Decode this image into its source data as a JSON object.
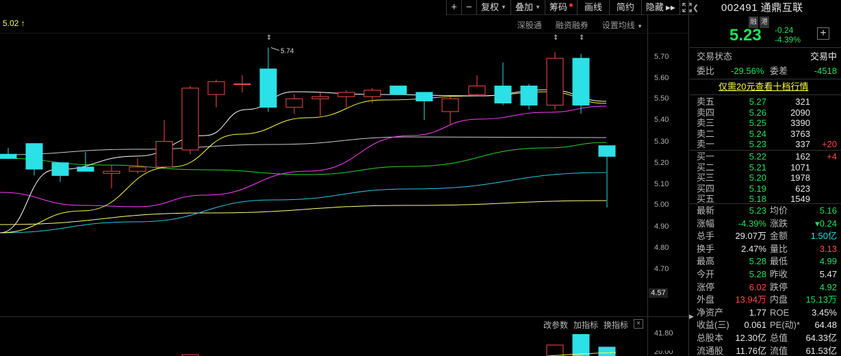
{
  "toolbar": {
    "plus": "+",
    "minus": "−",
    "fuquan": "复权",
    "diejia": "叠加",
    "chouma": "筹码",
    "huaxian": "画线",
    "jianyue": "简约",
    "yincang": "隐藏"
  },
  "chart_header": {
    "price": "5.02",
    "links": [
      "深股通",
      "融资融券",
      "设置均线"
    ]
  },
  "markers": {
    "high": "5.74"
  },
  "axis": {
    "labels": [
      "5.70",
      "5.60",
      "5.50",
      "5.40",
      "5.30",
      "5.20",
      "5.10",
      "5.00",
      "4.90",
      "4.80",
      "4.70"
    ],
    "current": "4.57",
    "volume_labels": [
      "41.80",
      "20.00"
    ]
  },
  "indicator_bar": {
    "modify": "改参数",
    "add": "加指标",
    "switch": "换指标",
    "close": "×"
  },
  "panel": {
    "code": "002491",
    "name": "通鼎互联",
    "tags": [
      "融",
      "港"
    ],
    "price": "5.23",
    "change": "-0.24",
    "change_pct": "-4.39%",
    "add_icon": "+",
    "status_label": "交易状态",
    "status_value": "交易中",
    "weibi_label": "委比",
    "weibi_value": "-29.56%",
    "weicha_label": "委差",
    "weicha_value": "-4518",
    "promo": "仅需20元查看十档行情",
    "sells": [
      {
        "label": "卖五",
        "price": "5.27",
        "vol": "321",
        "delta": ""
      },
      {
        "label": "卖四",
        "price": "5.26",
        "vol": "2090",
        "delta": ""
      },
      {
        "label": "卖三",
        "price": "5.25",
        "vol": "3390",
        "delta": ""
      },
      {
        "label": "卖二",
        "price": "5.24",
        "vol": "3763",
        "delta": ""
      },
      {
        "label": "卖一",
        "price": "5.23",
        "vol": "337",
        "delta": "+20"
      }
    ],
    "buys": [
      {
        "label": "买一",
        "price": "5.22",
        "vol": "162",
        "delta": "+4"
      },
      {
        "label": "买二",
        "price": "5.21",
        "vol": "1071",
        "delta": ""
      },
      {
        "label": "买三",
        "price": "5.20",
        "vol": "1978",
        "delta": ""
      },
      {
        "label": "买四",
        "price": "5.19",
        "vol": "623",
        "delta": ""
      },
      {
        "label": "买五",
        "price": "5.18",
        "vol": "1549",
        "delta": ""
      }
    ],
    "stats": [
      {
        "l1": "最新",
        "v1": "5.23",
        "c1": "g",
        "l2": "均价",
        "v2": "5.16",
        "c2": "g"
      },
      {
        "l1": "涨幅",
        "v1": "-4.39%",
        "c1": "g",
        "l2": "涨跌",
        "v2": "▾0.24",
        "c2": "g"
      },
      {
        "l1": "总手",
        "v1": "29.07万",
        "c1": "w",
        "l2": "金额",
        "v2": "1.50亿",
        "c2": "c"
      },
      {
        "l1": "换手",
        "v1": "2.47%",
        "c1": "w",
        "l2": "量比",
        "v2": "3.13",
        "c2": "r"
      },
      {
        "l1": "最高",
        "v1": "5.28",
        "c1": "g",
        "l2": "最低",
        "v2": "4.99",
        "c2": "g"
      },
      {
        "l1": "今开",
        "v1": "5.28",
        "c1": "g",
        "l2": "昨收",
        "v2": "5.47",
        "c2": "w"
      },
      {
        "l1": "涨停",
        "v1": "6.02",
        "c1": "r",
        "l2": "跌停",
        "v2": "4.92",
        "c2": "g"
      },
      {
        "l1": "外盘",
        "v1": "13.94万",
        "c1": "r",
        "l2": "内盘",
        "v2": "15.13万",
        "c2": "g"
      },
      {
        "l1": "净资产",
        "v1": "1.77",
        "c1": "w",
        "l2": "ROE",
        "v2": "3.45%",
        "c2": "w"
      },
      {
        "l1": "收益(三)",
        "v1": "0.061",
        "c1": "w",
        "l2": "PE(动)*",
        "v2": "64.48",
        "c2": "w"
      },
      {
        "l1": "总股本",
        "v1": "12.30亿",
        "c1": "w",
        "l2": "总值",
        "v2": "64.33亿",
        "c2": "w"
      },
      {
        "l1": "流通股",
        "v1": "11.76亿",
        "c1": "w",
        "l2": "流值",
        "v2": "61.53亿",
        "c2": "w"
      }
    ]
  },
  "candles": [
    {
      "o": 5.24,
      "c": 5.22,
      "h": 5.27,
      "l": 5.22
    },
    {
      "o": 5.29,
      "c": 5.17,
      "h": 5.29,
      "l": 5.14
    },
    {
      "o": 5.2,
      "c": 5.14,
      "h": 5.2,
      "l": 5.11
    },
    {
      "o": 5.18,
      "c": 5.16,
      "h": 5.25,
      "l": 5.16
    },
    {
      "o": 5.15,
      "c": 5.16,
      "h": 5.19,
      "l": 5.08
    },
    {
      "o": 5.16,
      "c": 5.18,
      "h": 5.22,
      "l": 5.15
    },
    {
      "o": 5.18,
      "c": 5.3,
      "h": 5.4,
      "l": 5.17
    },
    {
      "o": 5.26,
      "c": 5.55,
      "h": 5.56,
      "l": 5.24
    },
    {
      "o": 5.52,
      "c": 5.58,
      "h": 5.59,
      "l": 5.46
    },
    {
      "o": 5.57,
      "c": 5.57,
      "h": 5.61,
      "l": 5.53
    },
    {
      "o": 5.64,
      "c": 5.46,
      "h": 5.74,
      "l": 5.44
    },
    {
      "o": 5.46,
      "c": 5.5,
      "h": 5.52,
      "l": 5.43
    },
    {
      "o": 5.5,
      "c": 5.51,
      "h": 5.53,
      "l": 5.42
    },
    {
      "o": 5.51,
      "c": 5.53,
      "h": 5.54,
      "l": 5.46
    },
    {
      "o": 5.51,
      "c": 5.54,
      "h": 5.55,
      "l": 5.48
    },
    {
      "o": 5.56,
      "c": 5.52,
      "h": 5.56,
      "l": 5.52
    },
    {
      "o": 5.53,
      "c": 5.49,
      "h": 5.53,
      "l": 5.4
    },
    {
      "o": 5.44,
      "c": 5.5,
      "h": 5.51,
      "l": 5.38
    },
    {
      "o": 5.52,
      "c": 5.56,
      "h": 5.61,
      "l": 5.51
    },
    {
      "o": 5.56,
      "c": 5.48,
      "h": 5.67,
      "l": 5.47
    },
    {
      "o": 5.56,
      "c": 5.47,
      "h": 5.57,
      "l": 5.45
    },
    {
      "o": 5.47,
      "c": 5.69,
      "h": 5.72,
      "l": 5.45
    },
    {
      "o": 5.69,
      "c": 5.47,
      "h": 5.71,
      "l": 5.43
    },
    {
      "o": 5.28,
      "c": 5.23,
      "h": 5.28,
      "l": 4.99
    }
  ],
  "colors": {
    "up": "#ff4848",
    "down": "#2be0e6",
    "ma5": "#ffffff",
    "ma10": "#ffff40",
    "ma20": "#ff40ff",
    "ma30": "#2bd62b",
    "ma60": "#cccccc",
    "ma120": "#2bc8e6",
    "ma250": "#ffff80"
  }
}
